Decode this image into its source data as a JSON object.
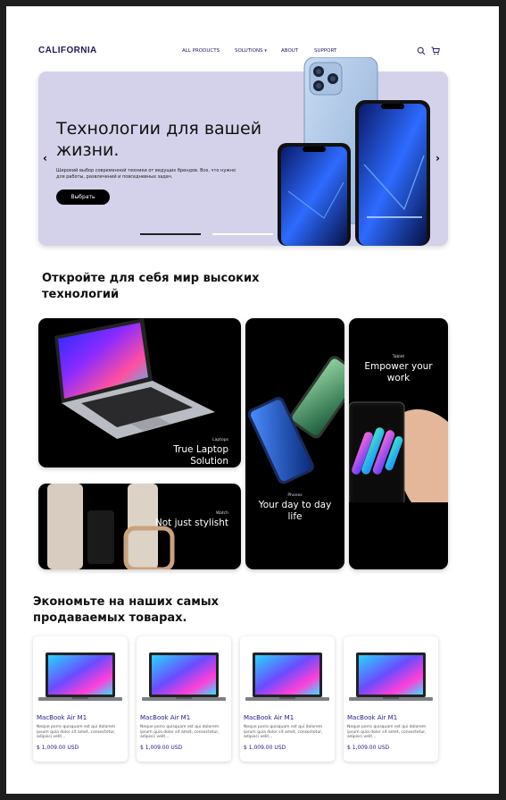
{
  "nav": {
    "logo": "CALIFORNIA",
    "items": [
      {
        "label": "ALL PRODUCTS"
      },
      {
        "label": "SOLUTIONS"
      },
      {
        "label": "ABOUT"
      },
      {
        "label": "SUPPORT"
      }
    ]
  },
  "hero": {
    "title": "Технологии для вашей жизни.",
    "subtitle": "Широкий выбор современной техники от ведущих брендов. Все, что нужно для работы, развлечений и повседневных задач.",
    "button": "Выбрать",
    "prev_icon": "‹",
    "next_icon": "›",
    "slides_total": 3,
    "slide_active": 1
  },
  "discover": {
    "title": "Откройте для себя мир высоких технологий",
    "cards": [
      {
        "category": "Laptops",
        "title": "True Laptop Solution"
      },
      {
        "category": "Watch",
        "title": "Not just stylisht"
      },
      {
        "category": "Phones",
        "title": "Your day to day life"
      },
      {
        "category": "Tablet",
        "title": "Empower your work"
      }
    ]
  },
  "bestsellers": {
    "title": "Экономьте на наших самых продаваемых товарах.",
    "products": [
      {
        "name": "MacBook Air M1",
        "desc": "Neque porro quisquam est qui dolorem ipsum quia dolor sit amet, consectetur, adipisci velit...",
        "price": "$ 1,009.00 USD"
      },
      {
        "name": "MacBook Air M1",
        "desc": "Neque porro quisquam est qui dolorem ipsum quia dolor sit amet, consectetur, adipisci velit...",
        "price": "$ 1,009.00 USD"
      },
      {
        "name": "MacBook Air M1",
        "desc": "Neque porro quisquam est qui dolorem ipsum quia dolor sit amet, consectetur, adipisci velit...",
        "price": "$ 1,009.00 USD"
      },
      {
        "name": "MacBook Air M1",
        "desc": "Neque porro quisquam est qui dolorem ipsum quia dolor sit amet, consectetur, adipisci velit...",
        "price": "$ 1,009.00 USD"
      }
    ]
  },
  "colors": {
    "brand": "#1f1a5c",
    "hero_bg": "#d4d1ea",
    "price": "#1f1a8c"
  },
  "icons": {
    "search": "search-icon",
    "cart": "cart-icon"
  }
}
